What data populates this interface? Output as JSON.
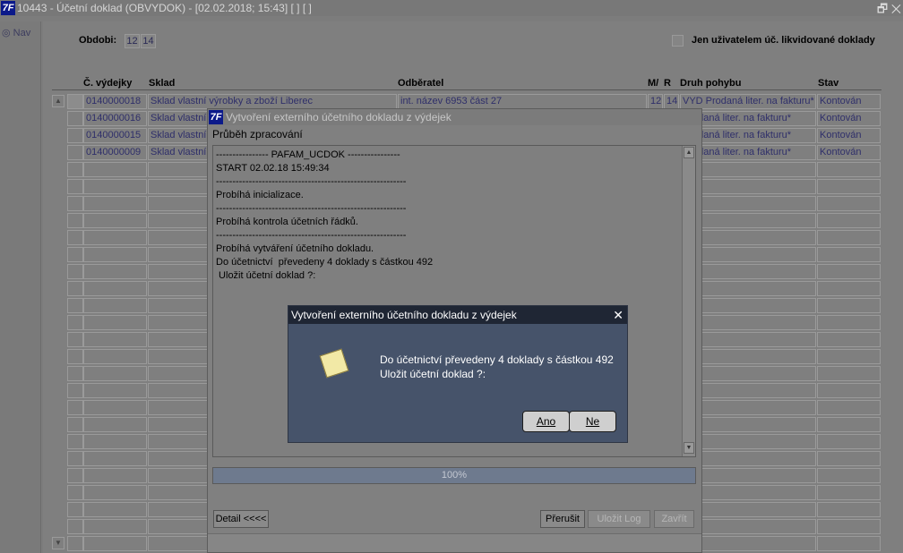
{
  "window": {
    "title": "10443 - Účetní doklad (OBVYDOK) - [02.02.2018; 15:43]  [ ]  [ ]",
    "logo": "7F",
    "restore_icon": "restore-icon",
    "close_icon": "close-icon"
  },
  "nav": {
    "label": "Nav"
  },
  "filter": {
    "obdobi_label": "Obdobi:",
    "month": "12",
    "year": "14",
    "checkbox_label": "Jen uživatelem úč. likvidované doklady"
  },
  "table": {
    "headers": [
      "Č. výdejky",
      "Sklad",
      "Odběratel",
      "M/",
      "R",
      "Druh pohybu",
      "Stav"
    ],
    "rows": [
      {
        "vydejka": "0140000018",
        "sklad": "Sklad vlastní výrobky a zboží Liberec",
        "odberatel": "int. název 6953 část 27",
        "m": "12",
        "r": "14",
        "druh": "VYD Prodaná liter. na fakturu*",
        "stav": "Kontován"
      },
      {
        "vydejka": "0140000016",
        "sklad": "Sklad vlastní",
        "odberatel": "",
        "m": "",
        "r": "",
        "druh": "Prodaná liter. na fakturu*",
        "stav": "Kontován"
      },
      {
        "vydejka": "0140000015",
        "sklad": "Sklad vlastní",
        "odberatel": "",
        "m": "",
        "r": "",
        "druh": "Prodaná liter. na fakturu*",
        "stav": "Kontován"
      },
      {
        "vydejka": "0140000009",
        "sklad": "Sklad vlastní",
        "odberatel": "",
        "m": "",
        "r": "",
        "druh": "Prodaná liter. na fakturu*",
        "stav": "Kontován"
      }
    ]
  },
  "dialog": {
    "title": "Vytvoření externího účetního dokladu z výdejek",
    "subtitle": "Průběh zpracování",
    "log": [
      "---------------- PAFAM_UCDOK ----------------",
      "START 02.02.18 15:49:34",
      "----------------------------------------------------------",
      "Probíhá inicializace.",
      "----------------------------------------------------------",
      "Probíhá kontrola účetních řádků.",
      "----------------------------------------------------------",
      "Probíhá vytváření účetního dokladu.",
      "Do účetnictví  převedeny 4 doklady s částkou 492",
      " Uložit účetní doklad ?:"
    ],
    "progress": "100%",
    "detail_btn": "Detail <<<<",
    "interrupt_btn": "Přerušit",
    "savelog_btn": "Uložit Log",
    "close_btn": "Zavřít"
  },
  "msgbox": {
    "title": "Vytvoření externího účetního dokladu z výdejek",
    "line1": "Do účetnictví  převedeny 4 doklady s částkou 492",
    "line2": " Uložit účetní doklad ?:",
    "yes": "Ano",
    "no": "Ne",
    "icon": "note-icon"
  }
}
